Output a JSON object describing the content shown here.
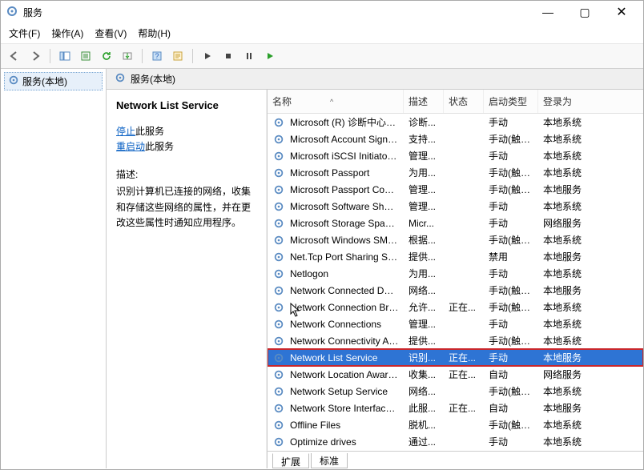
{
  "window": {
    "title": "服务",
    "min": "—",
    "max": "▢",
    "close": "✕"
  },
  "menu": {
    "file": "文件(F)",
    "action": "操作(A)",
    "view": "查看(V)",
    "help": "帮助(H)"
  },
  "tree": {
    "root": "服务(本地)"
  },
  "panel_header": "服务(本地)",
  "detail": {
    "title": "Network List Service",
    "stop_label": "停止",
    "stop_suffix": "此服务",
    "restart_label": "重启动",
    "restart_suffix": "此服务",
    "desc_label": "描述:",
    "desc_text": "识别计算机已连接的网络，收集和存储这些网络的属性，并在更改这些属性时通知应用程序。"
  },
  "columns": {
    "name": "名称",
    "desc": "描述",
    "status": "状态",
    "start": "启动类型",
    "logon": "登录为"
  },
  "sort_indicator": "^",
  "rows": [
    {
      "name": "Microsoft (R) 诊断中心标...",
      "desc": "诊断...",
      "status": "",
      "start": "手动",
      "logon": "本地系统"
    },
    {
      "name": "Microsoft Account Sign-i...",
      "desc": "支持...",
      "status": "",
      "start": "手动(触发...",
      "logon": "本地系统"
    },
    {
      "name": "Microsoft iSCSI Initiator ...",
      "desc": "管理...",
      "status": "",
      "start": "手动",
      "logon": "本地系统"
    },
    {
      "name": "Microsoft Passport",
      "desc": "为用...",
      "status": "",
      "start": "手动(触发...",
      "logon": "本地系统"
    },
    {
      "name": "Microsoft Passport Cont...",
      "desc": "管理...",
      "status": "",
      "start": "手动(触发...",
      "logon": "本地服务"
    },
    {
      "name": "Microsoft Software Shad...",
      "desc": "管理...",
      "status": "",
      "start": "手动",
      "logon": "本地系统"
    },
    {
      "name": "Microsoft Storage Space...",
      "desc": "Micr...",
      "status": "",
      "start": "手动",
      "logon": "网络服务"
    },
    {
      "name": "Microsoft Windows SMS ...",
      "desc": "根据...",
      "status": "",
      "start": "手动(触发...",
      "logon": "本地系统"
    },
    {
      "name": "Net.Tcp Port Sharing Ser...",
      "desc": "提供...",
      "status": "",
      "start": "禁用",
      "logon": "本地服务"
    },
    {
      "name": "Netlogon",
      "desc": "为用...",
      "status": "",
      "start": "手动",
      "logon": "本地系统"
    },
    {
      "name": "Network Connected Devi...",
      "desc": "网络...",
      "status": "",
      "start": "手动(触发...",
      "logon": "本地服务"
    },
    {
      "name": "Network Connection Bro...",
      "desc": "允许...",
      "status": "正在...",
      "start": "手动(触发...",
      "logon": "本地系统"
    },
    {
      "name": "Network Connections",
      "desc": "管理...",
      "status": "",
      "start": "手动",
      "logon": "本地系统"
    },
    {
      "name": "Network Connectivity Ass...",
      "desc": "提供...",
      "status": "",
      "start": "手动(触发...",
      "logon": "本地系统"
    },
    {
      "name": "Network List Service",
      "desc": "识别...",
      "status": "正在...",
      "start": "手动",
      "logon": "本地服务",
      "selected": true
    },
    {
      "name": "Network Location Aware...",
      "desc": "收集...",
      "status": "正在...",
      "start": "自动",
      "logon": "网络服务"
    },
    {
      "name": "Network Setup Service",
      "desc": "网络...",
      "status": "",
      "start": "手动(触发...",
      "logon": "本地系统"
    },
    {
      "name": "Network Store Interface ...",
      "desc": "此服...",
      "status": "正在...",
      "start": "自动",
      "logon": "本地服务"
    },
    {
      "name": "Offline Files",
      "desc": "脱机...",
      "status": "",
      "start": "手动(触发...",
      "logon": "本地系统"
    },
    {
      "name": "Optimize drives",
      "desc": "通过...",
      "status": "",
      "start": "手动",
      "logon": "本地系统"
    }
  ],
  "tabs": {
    "extended": "扩展",
    "standard": "标准"
  }
}
